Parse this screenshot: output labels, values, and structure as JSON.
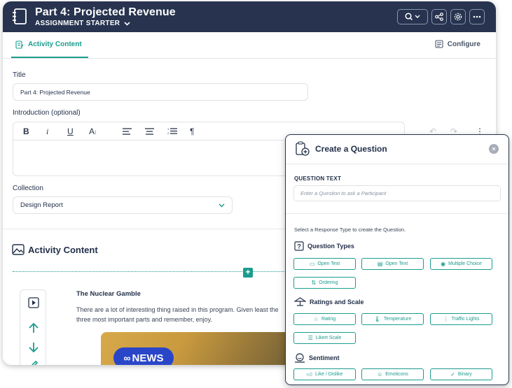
{
  "header": {
    "title": "Part 4: Projected Revenue",
    "subtitle": "ASSIGNMENT STARTER"
  },
  "tabs": {
    "activity": "Activity Content",
    "configure": "Configure"
  },
  "form": {
    "title_label": "Title",
    "title_value": "Part 4: Projected Revenue",
    "intro_label": "Introduction (optional)",
    "collection_label": "Collection",
    "collection_value": "Design Report"
  },
  "editor_toolbar": {
    "bold": "B",
    "italic": "i",
    "underline": "U",
    "font_size": "A",
    "paragraph": "¶",
    "more": "⋮"
  },
  "content": {
    "section_title": "Activity Content",
    "plus": "+",
    "activity_heading": "The Nuclear Gamble",
    "activity_body": "There are a lot of interesting thing raised in this program.  Given least the three most important parts and remember, enjoy.",
    "news_badge": "NEWS"
  },
  "modal": {
    "title": "Create a Question",
    "close": "×",
    "question_label": "QUESTION TEXT",
    "question_placeholder": "Enter a Question to ask a Participant",
    "hint": "Select a Response Type to create the Question.",
    "groups": {
      "question_types": {
        "label": "Question Types",
        "items": [
          "Open Text",
          "Open Text",
          "Multiple Choice",
          "Ordering"
        ]
      },
      "ratings": {
        "label": "Ratings and Scale",
        "items": [
          "Rating",
          "Temperature",
          "Traffic Lights",
          "Likert Scale"
        ]
      },
      "sentiment": {
        "label": "Sentiment",
        "items": [
          "Like / Dislike",
          "Emoticons",
          "Binary"
        ]
      }
    }
  },
  "colors": {
    "topbar": "#27334f",
    "accent": "#1a9c8e"
  },
  "icons": [
    "notebook-icon",
    "chevron-down-icon",
    "search-icon",
    "share-icon",
    "gear-icon",
    "more-icon",
    "edit-doc-icon",
    "configure-icon",
    "image-icon",
    "video-icon",
    "arrow-up-icon",
    "arrow-down-icon",
    "pencil-icon",
    "question-icon",
    "star-icon",
    "thermometer-icon",
    "traffic-light-icon",
    "list-icon",
    "like-dislike-icon",
    "emoticon-icon",
    "binary-icon"
  ]
}
